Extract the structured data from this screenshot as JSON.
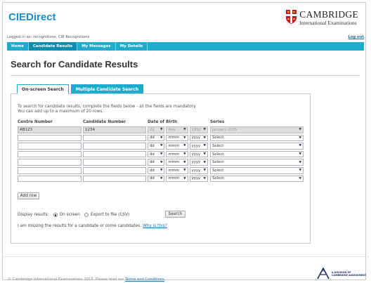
{
  "header": {
    "brand_cie": "CIE",
    "brand_direct": "Direct",
    "logo_name": "CAMBRIDGE",
    "logo_sub": "International Examinations"
  },
  "login": {
    "text": "Logged in as: recognitions, CIE Recognitions",
    "logout": "Log out"
  },
  "nav": {
    "items": [
      {
        "label": "Home"
      },
      {
        "label": "Candidate Results"
      },
      {
        "label": "My Messages"
      },
      {
        "label": "My Details"
      }
    ],
    "active": "Candidate Results"
  },
  "page_title": "Search for Candidate Results",
  "tabs": {
    "on_screen": "On-screen Search",
    "multiple": "Multiple Candidate Search"
  },
  "intro": {
    "line1": "To search for candidate results, complete the fields below - all the fields are mandatory.",
    "line2": "You can add up to a maximum of 20 rows."
  },
  "columns": {
    "centre": "Centre Number",
    "candidate": "Candidate Number",
    "dob": "Date of Birth",
    "series": "Series"
  },
  "rows": [
    {
      "centre": "AB123",
      "candidate": "1234",
      "dd": "22",
      "mm": "Nov",
      "yy": "1992",
      "series": "January 2005",
      "filled": true
    },
    {
      "centre": "",
      "candidate": "",
      "dd": "dd",
      "mm": "mmm",
      "yy": "yyyy",
      "series": "Select",
      "filled": false
    },
    {
      "centre": "",
      "candidate": "",
      "dd": "dd",
      "mm": "mmm",
      "yy": "yyyy",
      "series": "Select",
      "filled": false
    },
    {
      "centre": "",
      "candidate": "",
      "dd": "dd",
      "mm": "mmm",
      "yy": "yyyy",
      "series": "Select",
      "filled": false
    },
    {
      "centre": "",
      "candidate": "",
      "dd": "dd",
      "mm": "mmm",
      "yy": "yyyy",
      "series": "Select",
      "filled": false
    },
    {
      "centre": "",
      "candidate": "",
      "dd": "dd",
      "mm": "mmm",
      "yy": "yyyy",
      "series": "Select",
      "filled": false
    },
    {
      "centre": "",
      "candidate": "",
      "dd": "dd",
      "mm": "mmm",
      "yy": "yyyy",
      "series": "Select",
      "filled": false
    }
  ],
  "add_row": "Add row",
  "display": {
    "label": "Display results:",
    "on_screen": "On screen",
    "export": "Export to file (CSV)",
    "selected": "on_screen"
  },
  "search_button": "Search",
  "missing": {
    "text": "I am missing the results for a candidate or some candidates.",
    "link": "Why is this?"
  },
  "footer": {
    "text": "© Cambridge International Examinations 2015. Please read our",
    "link": "Terms and Conditions",
    "end": "."
  },
  "colors": {
    "accent": "#1eaccc",
    "brand": "#1b8fd6"
  },
  "icons": {
    "shield": "cambridge-shield-icon",
    "ucles": "ucles-logo-icon",
    "dropdown": "chevron-down-icon"
  }
}
